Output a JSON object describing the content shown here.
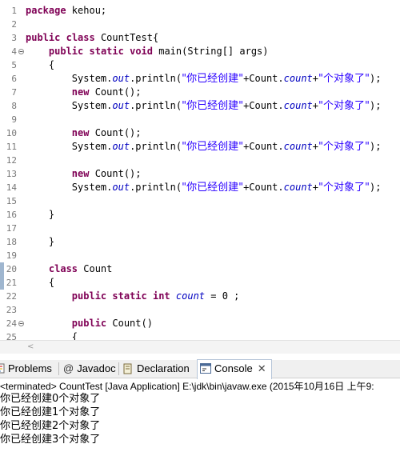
{
  "editor": {
    "lines": [
      {
        "n": "1",
        "t": [
          {
            "c": "kw",
            "s": "package"
          },
          {
            "s": " kehou;"
          }
        ]
      },
      {
        "n": "2",
        "t": []
      },
      {
        "n": "3",
        "t": [
          {
            "c": "kw",
            "s": "public"
          },
          {
            "s": " "
          },
          {
            "c": "kw",
            "s": "class"
          },
          {
            "s": " CountTest{"
          }
        ]
      },
      {
        "n": "4",
        "fold": true,
        "t": [
          {
            "s": "    "
          },
          {
            "c": "kw",
            "s": "public"
          },
          {
            "s": " "
          },
          {
            "c": "kw",
            "s": "static"
          },
          {
            "s": " "
          },
          {
            "c": "kw",
            "s": "void"
          },
          {
            "s": " main(String[] args)"
          }
        ]
      },
      {
        "n": "5",
        "t": [
          {
            "s": "    {"
          }
        ]
      },
      {
        "n": "6",
        "t": [
          {
            "s": "        System."
          },
          {
            "c": "fld",
            "s": "out"
          },
          {
            "s": ".println("
          },
          {
            "c": "str",
            "s": "\"你已经创建\""
          },
          {
            "s": "+Count."
          },
          {
            "c": "fld",
            "s": "count"
          },
          {
            "s": "+"
          },
          {
            "c": "str",
            "s": "\"个对象了\""
          },
          {
            "s": ");"
          }
        ]
      },
      {
        "n": "7",
        "t": [
          {
            "s": "        "
          },
          {
            "c": "kw",
            "s": "new"
          },
          {
            "s": " Count();"
          }
        ]
      },
      {
        "n": "8",
        "t": [
          {
            "s": "        System."
          },
          {
            "c": "fld",
            "s": "out"
          },
          {
            "s": ".println("
          },
          {
            "c": "str",
            "s": "\"你已经创建\""
          },
          {
            "s": "+Count."
          },
          {
            "c": "fld",
            "s": "count"
          },
          {
            "s": "+"
          },
          {
            "c": "str",
            "s": "\"个对象了\""
          },
          {
            "s": ");"
          }
        ]
      },
      {
        "n": "9",
        "t": []
      },
      {
        "n": "10",
        "t": [
          {
            "s": "        "
          },
          {
            "c": "kw",
            "s": "new"
          },
          {
            "s": " Count();"
          }
        ]
      },
      {
        "n": "11",
        "t": [
          {
            "s": "        System."
          },
          {
            "c": "fld",
            "s": "out"
          },
          {
            "s": ".println("
          },
          {
            "c": "str",
            "s": "\"你已经创建\""
          },
          {
            "s": "+Count."
          },
          {
            "c": "fld",
            "s": "count"
          },
          {
            "s": "+"
          },
          {
            "c": "str",
            "s": "\"个对象了\""
          },
          {
            "s": ");"
          }
        ]
      },
      {
        "n": "12",
        "t": []
      },
      {
        "n": "13",
        "t": [
          {
            "s": "        "
          },
          {
            "c": "kw",
            "s": "new"
          },
          {
            "s": " Count();"
          }
        ]
      },
      {
        "n": "14",
        "t": [
          {
            "s": "        System."
          },
          {
            "c": "fld",
            "s": "out"
          },
          {
            "s": ".println("
          },
          {
            "c": "str",
            "s": "\"你已经创建\""
          },
          {
            "s": "+Count."
          },
          {
            "c": "fld",
            "s": "count"
          },
          {
            "s": "+"
          },
          {
            "c": "str",
            "s": "\"个对象了\""
          },
          {
            "s": ");"
          }
        ]
      },
      {
        "n": "15",
        "t": []
      },
      {
        "n": "16",
        "t": [
          {
            "s": "    }"
          }
        ]
      },
      {
        "n": "17",
        "t": []
      },
      {
        "n": "18",
        "t": [
          {
            "s": "    }"
          }
        ]
      },
      {
        "n": "19",
        "t": []
      },
      {
        "n": "20",
        "marker": true,
        "t": [
          {
            "s": "    "
          },
          {
            "c": "kw",
            "s": "class"
          },
          {
            "s": " Count"
          }
        ]
      },
      {
        "n": "21",
        "marker": true,
        "t": [
          {
            "s": "    {"
          }
        ]
      },
      {
        "n": "22",
        "t": [
          {
            "s": "        "
          },
          {
            "c": "kw",
            "s": "public"
          },
          {
            "s": " "
          },
          {
            "c": "kw",
            "s": "static"
          },
          {
            "s": " "
          },
          {
            "c": "kw",
            "s": "int"
          },
          {
            "s": " "
          },
          {
            "c": "fld",
            "s": "count"
          },
          {
            "s": " = 0 ;"
          }
        ]
      },
      {
        "n": "23",
        "t": []
      },
      {
        "n": "24",
        "fold": true,
        "t": [
          {
            "s": "        "
          },
          {
            "c": "kw",
            "s": "public"
          },
          {
            "s": " Count()"
          }
        ]
      },
      {
        "n": "25",
        "t": [
          {
            "s": "        {"
          }
        ]
      }
    ]
  },
  "tabs": [
    {
      "id": "problems",
      "label": "Problems",
      "icon": "problems-icon"
    },
    {
      "id": "javadoc",
      "label": "Javadoc",
      "icon": "at-sign-icon"
    },
    {
      "id": "declaration",
      "label": "Declaration",
      "icon": "declaration-icon"
    },
    {
      "id": "console",
      "label": "Console",
      "icon": "console-icon",
      "active": true,
      "close": "✕"
    }
  ],
  "console": {
    "status": "<terminated> CountTest [Java Application] E:\\jdk\\bin\\javaw.exe (2015年10月16日 上午9:",
    "output": [
      "你已经创建0个对象了",
      "你已经创建1个对象了",
      "你已经创建2个对象了",
      "你已经创建3个对象了"
    ]
  },
  "scrollbar": {
    "left_arrow": "<"
  },
  "colors": {
    "keyword": "#7f0055",
    "field": "#0000c0",
    "string": "#2a00ff",
    "marker": "#9fb6cf"
  }
}
